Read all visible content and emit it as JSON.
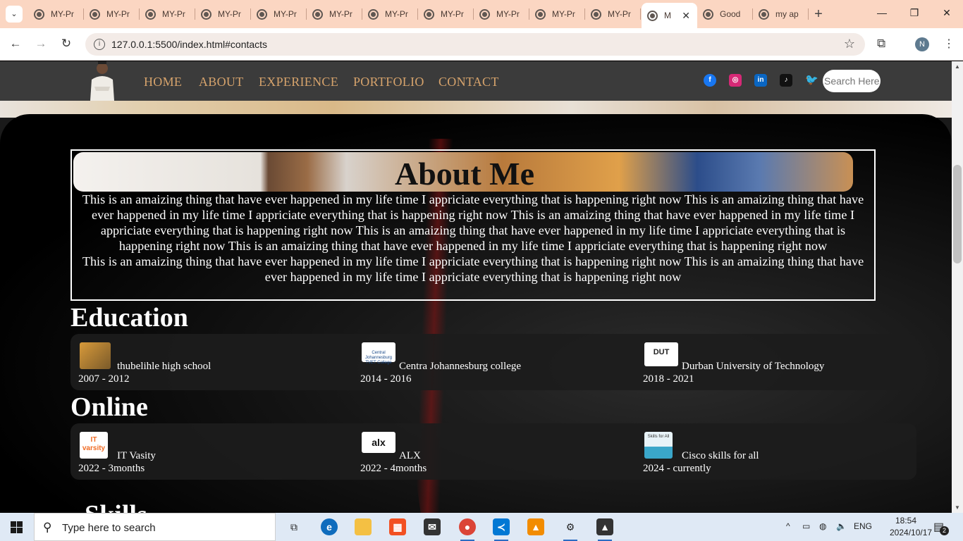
{
  "browser": {
    "tabs": [
      {
        "title": "MY-Pr"
      },
      {
        "title": "MY-Pr"
      },
      {
        "title": "MY-Pr"
      },
      {
        "title": "MY-Pr"
      },
      {
        "title": "MY-Pr"
      },
      {
        "title": "MY-Pr"
      },
      {
        "title": "MY-Pr"
      },
      {
        "title": "MY-Pr"
      },
      {
        "title": "MY-Pr"
      },
      {
        "title": "MY-Pr"
      },
      {
        "title": "MY-Pr"
      },
      {
        "title": "M",
        "active": true
      },
      {
        "title": "Good"
      },
      {
        "title": "my ap"
      }
    ],
    "url": "127.0.0.1:5500/index.html#contacts",
    "profile_initial": "N"
  },
  "site": {
    "nav": [
      "HOME",
      "ABOUT",
      "EXPERIENCE",
      "PORTFOLIO",
      "CONTACT"
    ],
    "social": [
      {
        "name": "facebook-icon",
        "color": "#1877f2"
      },
      {
        "name": "instagram-icon",
        "color": "#d62976"
      },
      {
        "name": "linkedin-icon",
        "color": "#0a66c2"
      },
      {
        "name": "tiktok-icon",
        "color": "#111111"
      },
      {
        "name": "twitter-icon",
        "color": "#1d9bf0"
      }
    ],
    "search_placeholder": "Search Here",
    "about": {
      "title": "About Me",
      "para1": "This is an amaizing thing that have ever happened in my life time I appriciate everything that is happening right now This is an amaizing thing that have ever happened in my life time I appriciate everything that is happening right now This is an amaizing thing that have ever happened in my life time I appriciate everything that is happening right now This is an amaizing thing that have ever happened in my life time I appriciate everything that is happening right now This is an amaizing thing that have ever happened in my life time I appriciate everything that is happening right now",
      "para2": "This is an amaizing thing that have ever happened in my life time I appriciate everything that is happening right now This is an amaizing thing that have ever happened in my life time I appriciate everything that is happening right now"
    },
    "education": {
      "heading": "Education",
      "items": [
        {
          "name": "thubelihle high school",
          "years": "2007 - 2012"
        },
        {
          "name": "Centra Johannesburg college",
          "years": "2014 - 2016",
          "logo_text": "Central Johannesburg TVET College"
        },
        {
          "name": "Durban University of Technology",
          "years": "2018 - 2021",
          "logo_text": "DUT"
        }
      ]
    },
    "online": {
      "heading": "Online",
      "items": [
        {
          "name": "IT Vasity",
          "years": "2022 - 3months",
          "logo_text": "IT varsity"
        },
        {
          "name": "ALX",
          "years": "2022 - 4months",
          "logo_text": "alx"
        },
        {
          "name": "Cisco skills for all",
          "years": "2024 - currently",
          "logo_text": "Skills for All"
        }
      ]
    },
    "skills_heading": "Skills"
  },
  "taskbar": {
    "search_placeholder": "Type here to search",
    "lang": "ENG",
    "time": "18:54",
    "date": "2024/10/17",
    "notifications": "2"
  }
}
